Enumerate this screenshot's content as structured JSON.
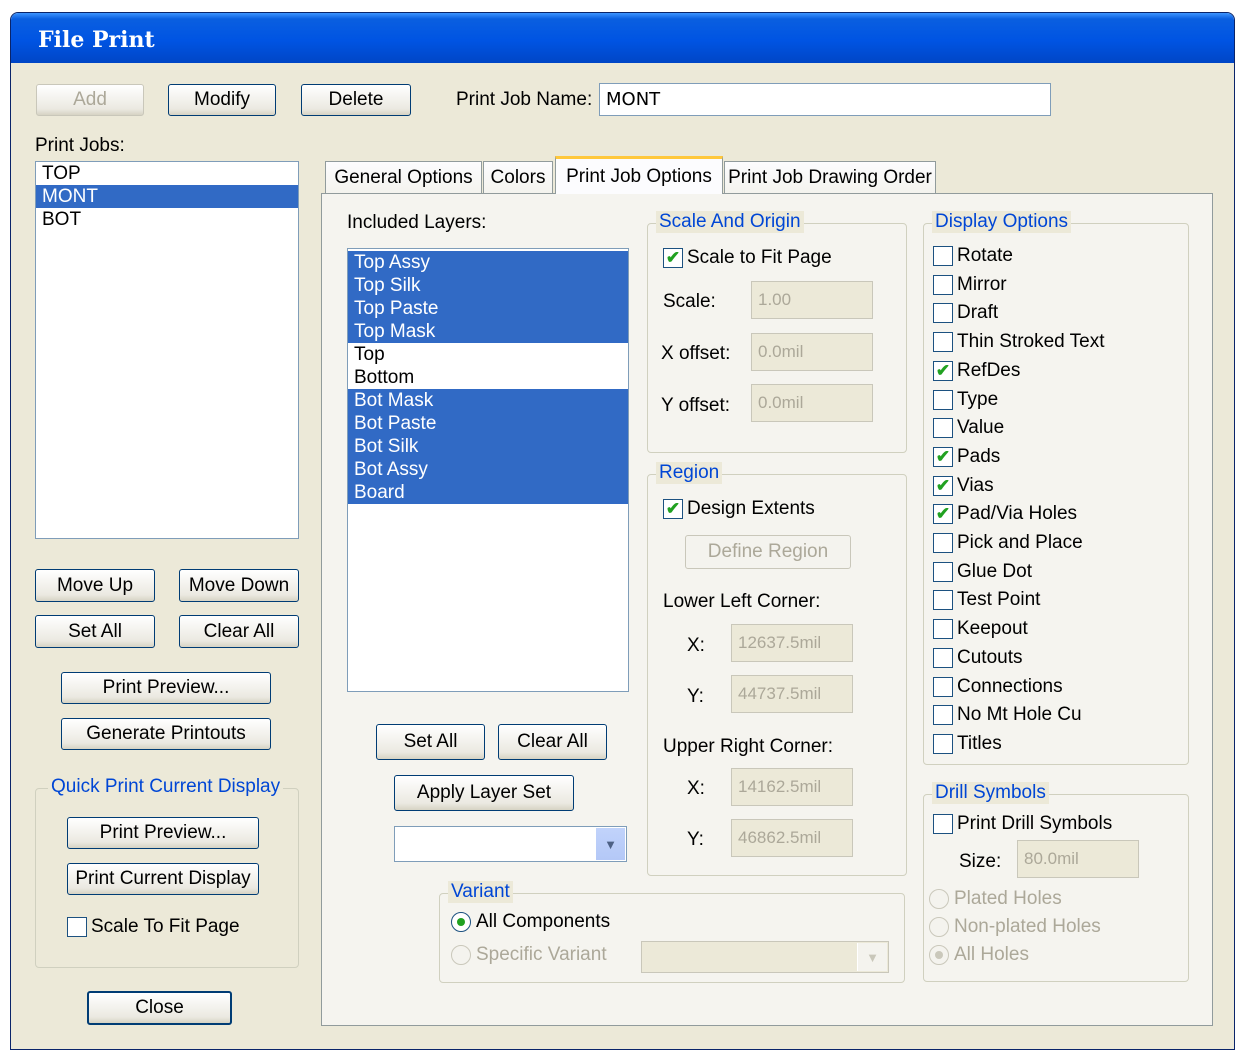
{
  "window": {
    "title": "File Print"
  },
  "top": {
    "add": "Add",
    "modify": "Modify",
    "delete": "Delete",
    "job_name_label": "Print Job Name:",
    "job_name_value": "MONT"
  },
  "print_jobs": {
    "label": "Print Jobs:",
    "items": [
      "TOP",
      "MONT",
      "BOT"
    ],
    "selected": "MONT"
  },
  "left_buttons": {
    "move_up": "Move Up",
    "move_down": "Move Down",
    "set_all": "Set All",
    "clear_all": "Clear All",
    "print_preview": "Print Preview...",
    "generate_printouts": "Generate Printouts"
  },
  "quick_print": {
    "title": "Quick Print Current Display",
    "print_preview": "Print Preview...",
    "print_current_display": "Print Current Display",
    "scale_to_fit": "Scale To Fit Page",
    "scale_to_fit_checked": false
  },
  "close": "Close",
  "tabs": [
    "General Options",
    "Colors",
    "Print Job Options",
    "Print Job Drawing Order"
  ],
  "active_tab": "Print Job Options",
  "layers": {
    "label": "Included Layers:",
    "items": [
      "Top Assy",
      "Top Silk",
      "Top Paste",
      "Top Mask",
      "Top",
      "Bottom",
      "Bot Mask",
      "Bot Paste",
      "Bot Silk",
      "Bot Assy",
      "Board"
    ],
    "selected": [
      "Top Assy",
      "Top Silk",
      "Top Paste",
      "Top Mask",
      "Bot Mask",
      "Bot Paste",
      "Bot Silk",
      "Bot Assy",
      "Board"
    ],
    "set_all": "Set All",
    "clear_all": "Clear All",
    "apply_layer_set": "Apply Layer Set",
    "layer_set_value": ""
  },
  "scale_origin": {
    "title": "Scale And Origin",
    "scale_to_fit": "Scale to Fit Page",
    "scale_to_fit_checked": true,
    "scale_label": "Scale:",
    "scale_value": "1.00",
    "xoffset_label": "X offset:",
    "xoffset_value": "0.0mil",
    "yoffset_label": "Y offset:",
    "yoffset_value": "0.0mil"
  },
  "region": {
    "title": "Region",
    "design_extents": "Design Extents",
    "design_extents_checked": true,
    "define_region": "Define Region",
    "lower_left": "Lower Left Corner:",
    "ll_x_label": "X:",
    "ll_x": "12637.5mil",
    "ll_y_label": "Y:",
    "ll_y": "44737.5mil",
    "upper_right": "Upper Right Corner:",
    "ur_x_label": "X:",
    "ur_x": "14162.5mil",
    "ur_y_label": "Y:",
    "ur_y": "46862.5mil"
  },
  "display_options": {
    "title": "Display Options",
    "items": [
      {
        "label": "Rotate",
        "checked": false
      },
      {
        "label": "Mirror",
        "checked": false
      },
      {
        "label": "Draft",
        "checked": false
      },
      {
        "label": "Thin Stroked Text",
        "checked": false
      },
      {
        "label": "RefDes",
        "checked": true
      },
      {
        "label": "Type",
        "checked": false
      },
      {
        "label": "Value",
        "checked": false
      },
      {
        "label": "Pads",
        "checked": true
      },
      {
        "label": "Vias",
        "checked": true
      },
      {
        "label": "Pad/Via Holes",
        "checked": true
      },
      {
        "label": "Pick and Place",
        "checked": false
      },
      {
        "label": "Glue Dot",
        "checked": false
      },
      {
        "label": "Test Point",
        "checked": false
      },
      {
        "label": "Keepout",
        "checked": false
      },
      {
        "label": "Cutouts",
        "checked": false
      },
      {
        "label": "Connections",
        "checked": false
      },
      {
        "label": "No Mt Hole Cu",
        "checked": false
      },
      {
        "label": "Titles",
        "checked": false
      }
    ]
  },
  "drill_symbols": {
    "title": "Drill Symbols",
    "print_drill_symbols": "Print Drill Symbols",
    "print_drill_checked": false,
    "size_label": "Size:",
    "size_value": "80.0mil",
    "plated": "Plated Holes",
    "non_plated": "Non-plated Holes",
    "all_holes": "All Holes"
  },
  "variant": {
    "title": "Variant",
    "all_components": "All Components",
    "specific_variant": "Specific Variant",
    "specific_value": ""
  }
}
